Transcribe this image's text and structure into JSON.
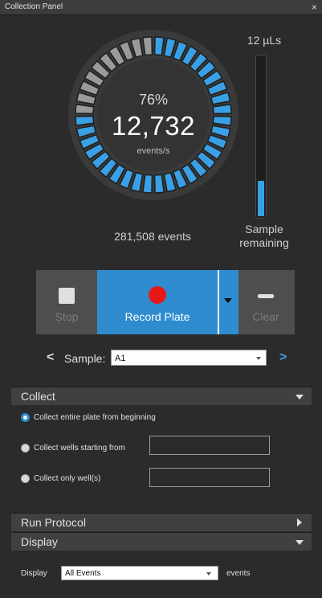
{
  "window": {
    "title": "Collection Panel",
    "close_symbol": "×"
  },
  "gauge": {
    "percent_label": "76%",
    "percent_value": 76,
    "rate": "12,732",
    "rate_unit": "events/s",
    "segments": 40,
    "active_color": "#3aa0e6",
    "inactive_color": "#9a9a9a"
  },
  "volume": {
    "label": "12 µLs",
    "level": 0.22,
    "fill_color": "#3aa0e6"
  },
  "events_label": "281,508 events",
  "sample_remaining_label": "Sample remaining",
  "controls": {
    "stop_label": "Stop",
    "record_label": "Record Plate",
    "clear_label": "Clear",
    "accent_color": "#2e8ccf",
    "record_dot_color": "#e81818"
  },
  "sample": {
    "label": "Sample:",
    "value": "A1",
    "prev_symbol": "<",
    "next_symbol": ">"
  },
  "collect": {
    "header": "Collect",
    "options": [
      {
        "label": "Collect entire plate from beginning",
        "selected": true
      },
      {
        "label": "Collect wells starting from",
        "selected": false
      },
      {
        "label": "Collect only well(s)",
        "selected": false
      }
    ]
  },
  "run_protocol": {
    "header": "Run Protocol"
  },
  "display": {
    "header": "Display",
    "label": "Display",
    "value": "All Events",
    "suffix": "events"
  }
}
